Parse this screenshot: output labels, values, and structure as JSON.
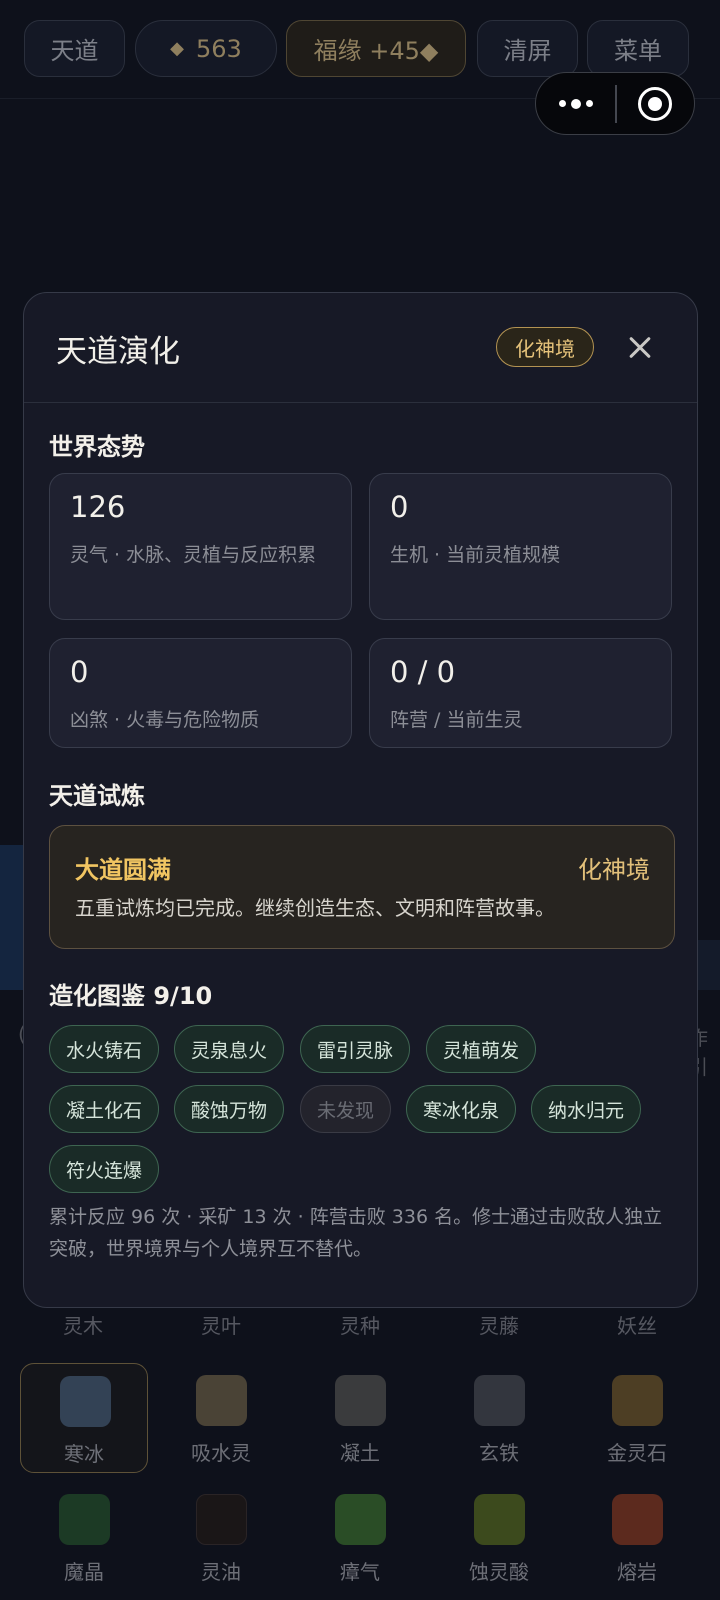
{
  "topbar": {
    "tiandao_label": "天道",
    "gem_icon_glyph": "◆",
    "gem_count": "563",
    "fortune_label": "福缘 +45◆",
    "clear_label": "清屏",
    "menu_label": "菜单"
  },
  "edge_text": {
    "left": "(",
    "right": "作引"
  },
  "modal": {
    "title": "天道演化",
    "realm_badge": "化神境",
    "world_section_title": "世界态势",
    "stats": [
      {
        "value": "126",
        "desc": "灵气 · 水脉、灵植与反应积累"
      },
      {
        "value": "0",
        "desc": "生机 · 当前灵植规模"
      },
      {
        "value": "0",
        "desc": "凶煞 · 火毒与危险物质"
      },
      {
        "value": "0 / 0",
        "desc": "阵营 / 当前生灵"
      }
    ],
    "trial_section_title": "天道试炼",
    "trial": {
      "name": "大道圆满",
      "realm": "化神境",
      "desc": "五重试炼均已完成。继续创造生态、文明和阵营故事。"
    },
    "codex_section_title": "造化图鉴 9/10",
    "codex_chips": [
      {
        "label": "水火铸石",
        "discovered": true
      },
      {
        "label": "灵泉息火",
        "discovered": true
      },
      {
        "label": "雷引灵脉",
        "discovered": true
      },
      {
        "label": "灵植萌发",
        "discovered": true
      },
      {
        "label": "凝土化石",
        "discovered": true
      },
      {
        "label": "酸蚀万物",
        "discovered": true
      },
      {
        "label": "未发现",
        "discovered": false
      },
      {
        "label": "寒冰化泉",
        "discovered": true
      },
      {
        "label": "纳水归元",
        "discovered": true
      },
      {
        "label": "符火连爆",
        "discovered": true
      }
    ],
    "footer_text": "累计反应 96 次 · 采矿 13 次 · 阵营击败 336 名。修士通过击败敌人独立突破，世界境界与个人境界互不替代。"
  },
  "material_palette": {
    "partial_row_labels": [
      "灵木",
      "灵叶",
      "灵种",
      "灵藤",
      "妖丝"
    ],
    "rows": [
      [
        {
          "label": "寒冰",
          "color": "#334255",
          "selected": true
        },
        {
          "label": "吸水灵",
          "color": "#4a4336",
          "selected": false
        },
        {
          "label": "凝土",
          "color": "#3a3b3d",
          "selected": false
        },
        {
          "label": "玄铁",
          "color": "#33363e",
          "selected": false
        },
        {
          "label": "金灵石",
          "color": "#4d3e24",
          "selected": false
        }
      ],
      [
        {
          "label": "魔晶",
          "color": "#1c3a25",
          "selected": false
        },
        {
          "label": "灵油",
          "color": "#1a1617",
          "selected": false
        },
        {
          "label": "瘴气",
          "color": "#2a4d26",
          "selected": false
        },
        {
          "label": "蚀灵酸",
          "color": "#3c4a1d",
          "selected": false
        },
        {
          "label": "熔岩",
          "color": "#5c2a1e",
          "selected": false
        }
      ]
    ]
  }
}
